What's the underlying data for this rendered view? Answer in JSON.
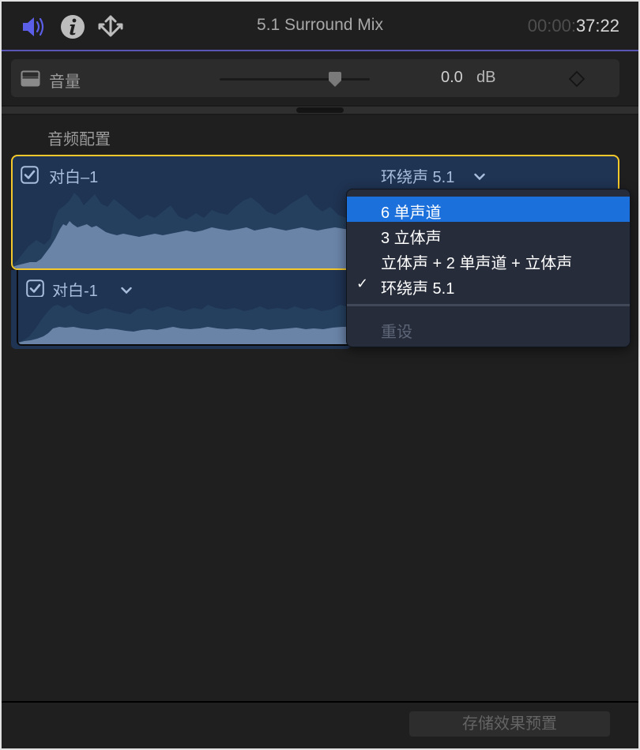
{
  "header": {
    "icons": [
      "audio-speaker-icon",
      "info-icon",
      "share-icon"
    ],
    "title": "5.1 Surround Mix",
    "timecode_dim": "00:00:",
    "timecode_bright": "37:22",
    "accent_color": "#5a56b8",
    "speaker_color": "#5b5ee6"
  },
  "volume": {
    "label": "音量",
    "value": "0.0",
    "unit": "dB",
    "slider_position_fraction": 0.76
  },
  "audio_config": {
    "section_label": "音频配置",
    "clips": [
      {
        "name": "对白–1",
        "checked": true,
        "channel_config": "环绕声 5.1",
        "selected": true
      },
      {
        "name": "对白-1",
        "checked": true
      }
    ]
  },
  "channel_menu": {
    "items": [
      {
        "label": "6 单声道",
        "highlighted": true,
        "checked": false
      },
      {
        "label": "3 立体声",
        "highlighted": false,
        "checked": false
      },
      {
        "label": "立体声 + 2 单声道 + 立体声",
        "highlighted": false,
        "checked": false
      },
      {
        "label": "环绕声 5.1",
        "highlighted": false,
        "checked": true
      }
    ],
    "check_glyph": "✓",
    "reset_label": "重设",
    "highlight_color": "#1b70dc"
  },
  "footer": {
    "save_preset_label": "存储效果预置"
  }
}
